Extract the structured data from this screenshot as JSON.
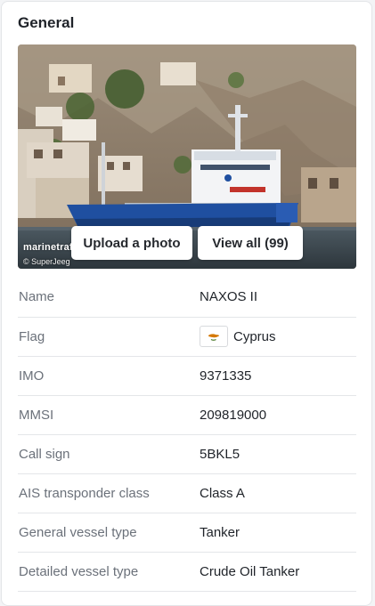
{
  "section": {
    "title": "General"
  },
  "photo": {
    "watermark": "marinetraffic",
    "credit": "© SuperJeeg",
    "upload_label": "Upload a photo",
    "view_all_label": "View all (99)"
  },
  "details": [
    {
      "label": "Name",
      "value": "NAXOS II"
    },
    {
      "label": "Flag",
      "value": "Cyprus",
      "flag_icon": "cyprus-flag-icon"
    },
    {
      "label": "IMO",
      "value": "9371335"
    },
    {
      "label": "MMSI",
      "value": "209819000"
    },
    {
      "label": "Call sign",
      "value": "5BKL5"
    },
    {
      "label": "AIS transponder class",
      "value": "Class A"
    },
    {
      "label": "General vessel type",
      "value": "Tanker"
    },
    {
      "label": "Detailed vessel type",
      "value": "Crude Oil Tanker"
    }
  ],
  "colors": {
    "label_text": "#6b717a",
    "value_text": "#1f2329",
    "divider": "#e4e6e9",
    "hull_blue": "#1f4fa0"
  }
}
